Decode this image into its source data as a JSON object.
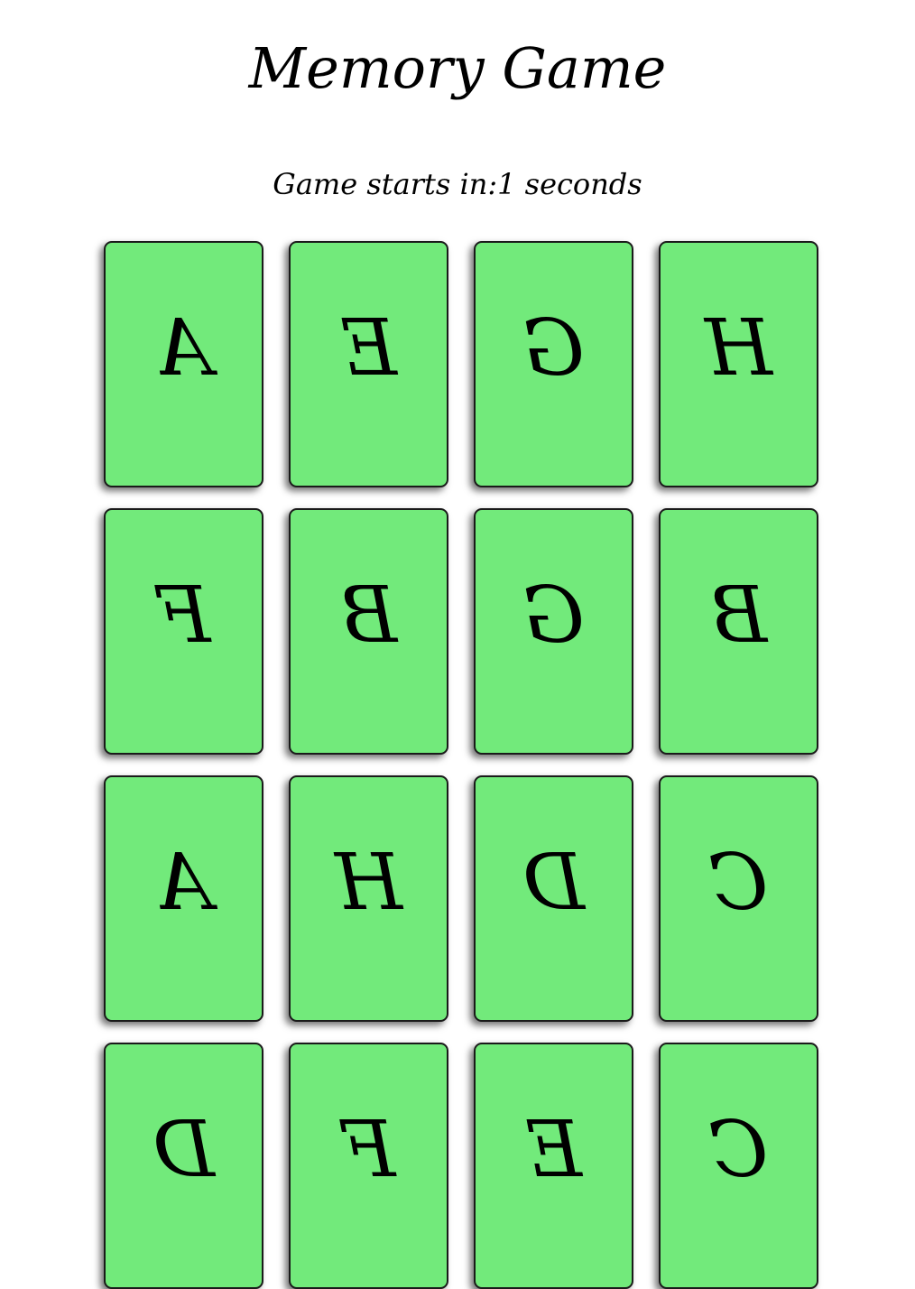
{
  "title": "Memory Game",
  "timer_text": "Game starts in:1 seconds",
  "colors": {
    "card_face": "#72ea7b",
    "card_border": "#1a1a1a",
    "background": "#ffffff"
  },
  "cards": [
    {
      "letter": "A"
    },
    {
      "letter": "E"
    },
    {
      "letter": "G"
    },
    {
      "letter": "H"
    },
    {
      "letter": "F"
    },
    {
      "letter": "B"
    },
    {
      "letter": "G"
    },
    {
      "letter": "B"
    },
    {
      "letter": "A"
    },
    {
      "letter": "H"
    },
    {
      "letter": "D"
    },
    {
      "letter": "C"
    },
    {
      "letter": "D"
    },
    {
      "letter": "F"
    },
    {
      "letter": "E"
    },
    {
      "letter": "C"
    }
  ]
}
